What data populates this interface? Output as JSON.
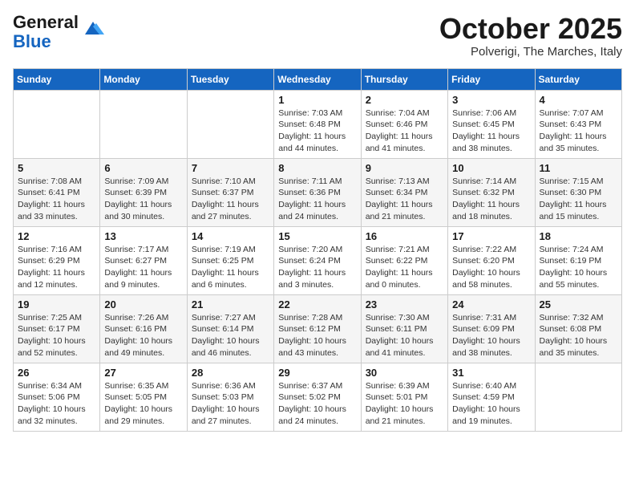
{
  "header": {
    "logo_line1": "General",
    "logo_line2": "Blue",
    "month_title": "October 2025",
    "location": "Polverigi, The Marches, Italy"
  },
  "weekdays": [
    "Sunday",
    "Monday",
    "Tuesday",
    "Wednesday",
    "Thursday",
    "Friday",
    "Saturday"
  ],
  "weeks": [
    [
      {
        "day": "",
        "info": ""
      },
      {
        "day": "",
        "info": ""
      },
      {
        "day": "",
        "info": ""
      },
      {
        "day": "1",
        "info": "Sunrise: 7:03 AM\nSunset: 6:48 PM\nDaylight: 11 hours and 44 minutes."
      },
      {
        "day": "2",
        "info": "Sunrise: 7:04 AM\nSunset: 6:46 PM\nDaylight: 11 hours and 41 minutes."
      },
      {
        "day": "3",
        "info": "Sunrise: 7:06 AM\nSunset: 6:45 PM\nDaylight: 11 hours and 38 minutes."
      },
      {
        "day": "4",
        "info": "Sunrise: 7:07 AM\nSunset: 6:43 PM\nDaylight: 11 hours and 35 minutes."
      }
    ],
    [
      {
        "day": "5",
        "info": "Sunrise: 7:08 AM\nSunset: 6:41 PM\nDaylight: 11 hours and 33 minutes."
      },
      {
        "day": "6",
        "info": "Sunrise: 7:09 AM\nSunset: 6:39 PM\nDaylight: 11 hours and 30 minutes."
      },
      {
        "day": "7",
        "info": "Sunrise: 7:10 AM\nSunset: 6:37 PM\nDaylight: 11 hours and 27 minutes."
      },
      {
        "day": "8",
        "info": "Sunrise: 7:11 AM\nSunset: 6:36 PM\nDaylight: 11 hours and 24 minutes."
      },
      {
        "day": "9",
        "info": "Sunrise: 7:13 AM\nSunset: 6:34 PM\nDaylight: 11 hours and 21 minutes."
      },
      {
        "day": "10",
        "info": "Sunrise: 7:14 AM\nSunset: 6:32 PM\nDaylight: 11 hours and 18 minutes."
      },
      {
        "day": "11",
        "info": "Sunrise: 7:15 AM\nSunset: 6:30 PM\nDaylight: 11 hours and 15 minutes."
      }
    ],
    [
      {
        "day": "12",
        "info": "Sunrise: 7:16 AM\nSunset: 6:29 PM\nDaylight: 11 hours and 12 minutes."
      },
      {
        "day": "13",
        "info": "Sunrise: 7:17 AM\nSunset: 6:27 PM\nDaylight: 11 hours and 9 minutes."
      },
      {
        "day": "14",
        "info": "Sunrise: 7:19 AM\nSunset: 6:25 PM\nDaylight: 11 hours and 6 minutes."
      },
      {
        "day": "15",
        "info": "Sunrise: 7:20 AM\nSunset: 6:24 PM\nDaylight: 11 hours and 3 minutes."
      },
      {
        "day": "16",
        "info": "Sunrise: 7:21 AM\nSunset: 6:22 PM\nDaylight: 11 hours and 0 minutes."
      },
      {
        "day": "17",
        "info": "Sunrise: 7:22 AM\nSunset: 6:20 PM\nDaylight: 10 hours and 58 minutes."
      },
      {
        "day": "18",
        "info": "Sunrise: 7:24 AM\nSunset: 6:19 PM\nDaylight: 10 hours and 55 minutes."
      }
    ],
    [
      {
        "day": "19",
        "info": "Sunrise: 7:25 AM\nSunset: 6:17 PM\nDaylight: 10 hours and 52 minutes."
      },
      {
        "day": "20",
        "info": "Sunrise: 7:26 AM\nSunset: 6:16 PM\nDaylight: 10 hours and 49 minutes."
      },
      {
        "day": "21",
        "info": "Sunrise: 7:27 AM\nSunset: 6:14 PM\nDaylight: 10 hours and 46 minutes."
      },
      {
        "day": "22",
        "info": "Sunrise: 7:28 AM\nSunset: 6:12 PM\nDaylight: 10 hours and 43 minutes."
      },
      {
        "day": "23",
        "info": "Sunrise: 7:30 AM\nSunset: 6:11 PM\nDaylight: 10 hours and 41 minutes."
      },
      {
        "day": "24",
        "info": "Sunrise: 7:31 AM\nSunset: 6:09 PM\nDaylight: 10 hours and 38 minutes."
      },
      {
        "day": "25",
        "info": "Sunrise: 7:32 AM\nSunset: 6:08 PM\nDaylight: 10 hours and 35 minutes."
      }
    ],
    [
      {
        "day": "26",
        "info": "Sunrise: 6:34 AM\nSunset: 5:06 PM\nDaylight: 10 hours and 32 minutes."
      },
      {
        "day": "27",
        "info": "Sunrise: 6:35 AM\nSunset: 5:05 PM\nDaylight: 10 hours and 29 minutes."
      },
      {
        "day": "28",
        "info": "Sunrise: 6:36 AM\nSunset: 5:03 PM\nDaylight: 10 hours and 27 minutes."
      },
      {
        "day": "29",
        "info": "Sunrise: 6:37 AM\nSunset: 5:02 PM\nDaylight: 10 hours and 24 minutes."
      },
      {
        "day": "30",
        "info": "Sunrise: 6:39 AM\nSunset: 5:01 PM\nDaylight: 10 hours and 21 minutes."
      },
      {
        "day": "31",
        "info": "Sunrise: 6:40 AM\nSunset: 4:59 PM\nDaylight: 10 hours and 19 minutes."
      },
      {
        "day": "",
        "info": ""
      }
    ]
  ]
}
